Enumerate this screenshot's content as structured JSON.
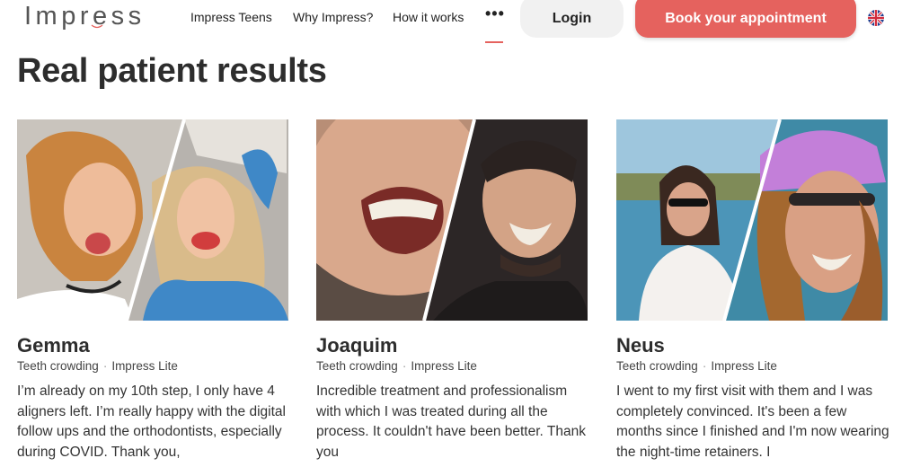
{
  "header": {
    "logo_text": "Impress",
    "nav": [
      "Impress Teens",
      "Why Impress?",
      "How it works"
    ],
    "more_label": "•••",
    "login_label": "Login",
    "book_label": "Book your appointment",
    "language_flag": "uk-flag-icon"
  },
  "colors": {
    "accent": "#e5625e",
    "login_bg": "#f1f1f1",
    "text": "#2d2d2d"
  },
  "page_title": "Real patient results",
  "cards": [
    {
      "name": "Gemma",
      "tag1": "Teeth crowding",
      "tag2": "Impress Lite",
      "quote": "I’m already on my 10th step, I only have 4 aligners left. I’m really happy with the digital follow ups and the orthodontists, especially during COVID. Thank you,"
    },
    {
      "name": "Joaquim",
      "tag1": "Teeth crowding",
      "tag2": "Impress Lite",
      "quote": "Incredible treatment and professionalism with which I was treated during all the process. It couldn't have been better. Thank you"
    },
    {
      "name": "Neus",
      "tag1": "Teeth crowding",
      "tag2": "Impress Lite",
      "quote": "I went to my first visit with them and I was completely convinced. It's been a few months since I finished and I'm now wearing the night-time retainers. I"
    }
  ]
}
